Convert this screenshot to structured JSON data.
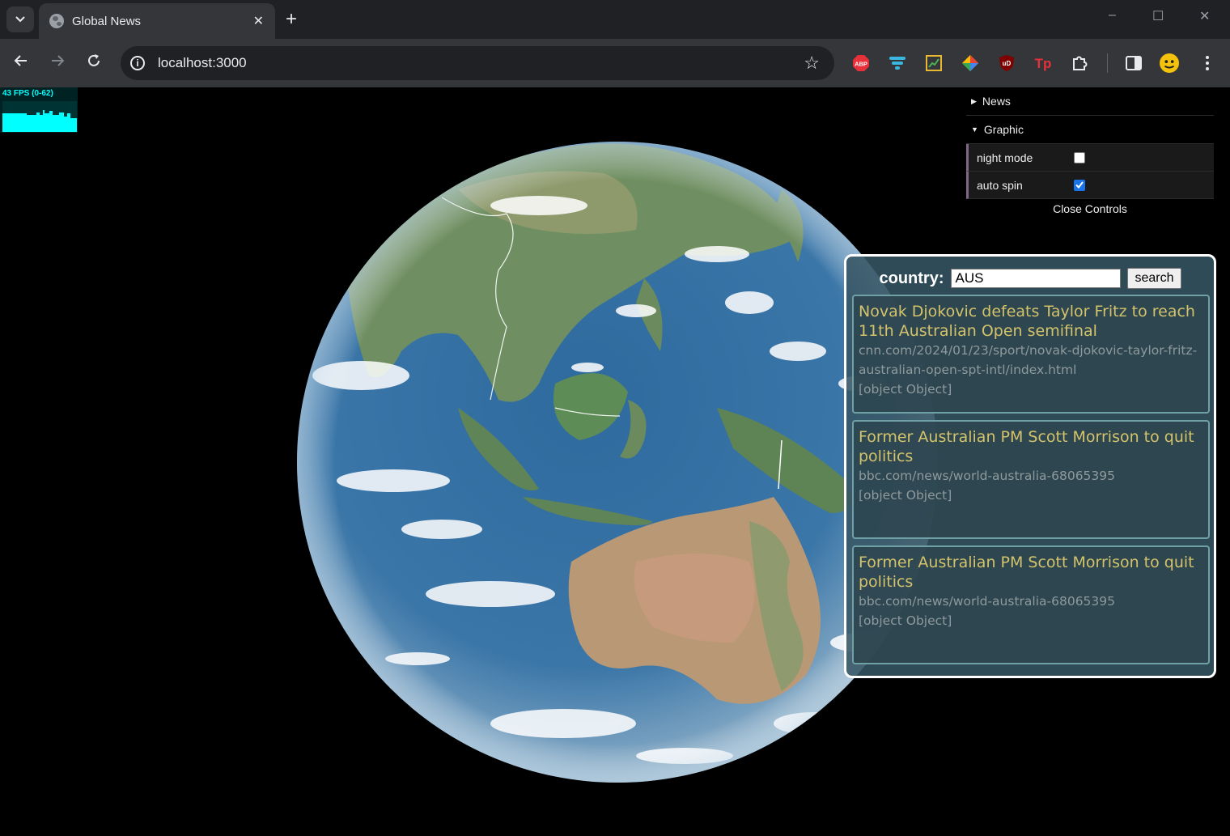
{
  "browser": {
    "tab_title": "Global News",
    "new_tab": "+",
    "tab_close": "✕",
    "url": "localhost:3000",
    "window_controls": [
      "–",
      "☐",
      "✕"
    ],
    "extensions": [
      "ABP",
      "filter-icon",
      "chart-icon",
      "diamond-icon",
      "uD",
      "Tp",
      "puzzle-icon"
    ]
  },
  "fps": {
    "label": "43 FPS (0-62)"
  },
  "gui": {
    "folder_news": "News",
    "folder_graphic": "Graphic",
    "night_mode_label": "night mode",
    "auto_spin_label": "auto spin",
    "night_mode": false,
    "auto_spin": true,
    "close_label": "Close Controls"
  },
  "search": {
    "label": "country:",
    "value": "AUS",
    "button": "search"
  },
  "articles": [
    {
      "title": "Novak Djokovic defeats Taylor Fritz to reach 11th Australian Open semifinal",
      "url": "cnn.com/2024/01/23/sport/novak-djokovic-taylor-fritz-australian-open-spt-intl/index.html",
      "extra": "[object Object]"
    },
    {
      "title": "Former Australian PM Scott Morrison to quit politics",
      "url": "bbc.com/news/world-australia-68065395",
      "extra": "[object Object]"
    },
    {
      "title": "Former Australian PM Scott Morrison to quit politics",
      "url": "bbc.com/news/world-australia-68065395",
      "extra": "[object Object]"
    }
  ]
}
